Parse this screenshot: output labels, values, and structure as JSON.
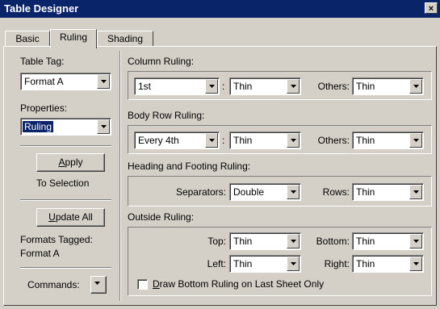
{
  "window": {
    "title": "Table Designer",
    "close_label": "×"
  },
  "tabs": [
    {
      "label": "Basic"
    },
    {
      "label": "Ruling"
    },
    {
      "label": "Shading"
    }
  ],
  "left": {
    "table_tag_label": "Table Tag:",
    "table_tag_value": "Format A",
    "properties_label": "Properties:",
    "properties_value": "Ruling",
    "apply_hotkey": "A",
    "apply_rest": "pply",
    "to_selection_label": "To Selection",
    "update_hotkey": "U",
    "update_rest": "pdate All",
    "formats_tagged_label": "Formats Tagged:",
    "formats_tagged_value": "Format A",
    "commands_label": "Commands:"
  },
  "column_ruling": {
    "heading": "Column Ruling:",
    "which_value": "1st",
    "colon": ":",
    "weight_value": "Thin",
    "others_label": "Others:",
    "others_value": "Thin"
  },
  "body_row_ruling": {
    "heading": "Body Row Ruling:",
    "which_value": "Every 4th",
    "colon": ":",
    "weight_value": "Thin",
    "others_label": "Others:",
    "others_value": "Thin"
  },
  "heading_footing": {
    "heading": "Heading and Footing Ruling:",
    "separators_label": "Separators:",
    "separators_value": "Double",
    "rows_label": "Rows:",
    "rows_value": "Thin"
  },
  "outside_ruling": {
    "heading": "Outside Ruling:",
    "top_label": "Top:",
    "top_value": "Thin",
    "bottom_label": "Bottom:",
    "bottom_value": "Thin",
    "left_label": "Left:",
    "left_value": "Thin",
    "right_label": "Right:",
    "right_value": "Thin",
    "checkbox_hotkey": "D",
    "checkbox_rest": "raw Bottom Ruling on Last Sheet Only",
    "checkbox_checked": false
  },
  "colors": {
    "titlebar": "#0a246a",
    "face": "#d4d0c8",
    "selection": "#0a246a"
  }
}
